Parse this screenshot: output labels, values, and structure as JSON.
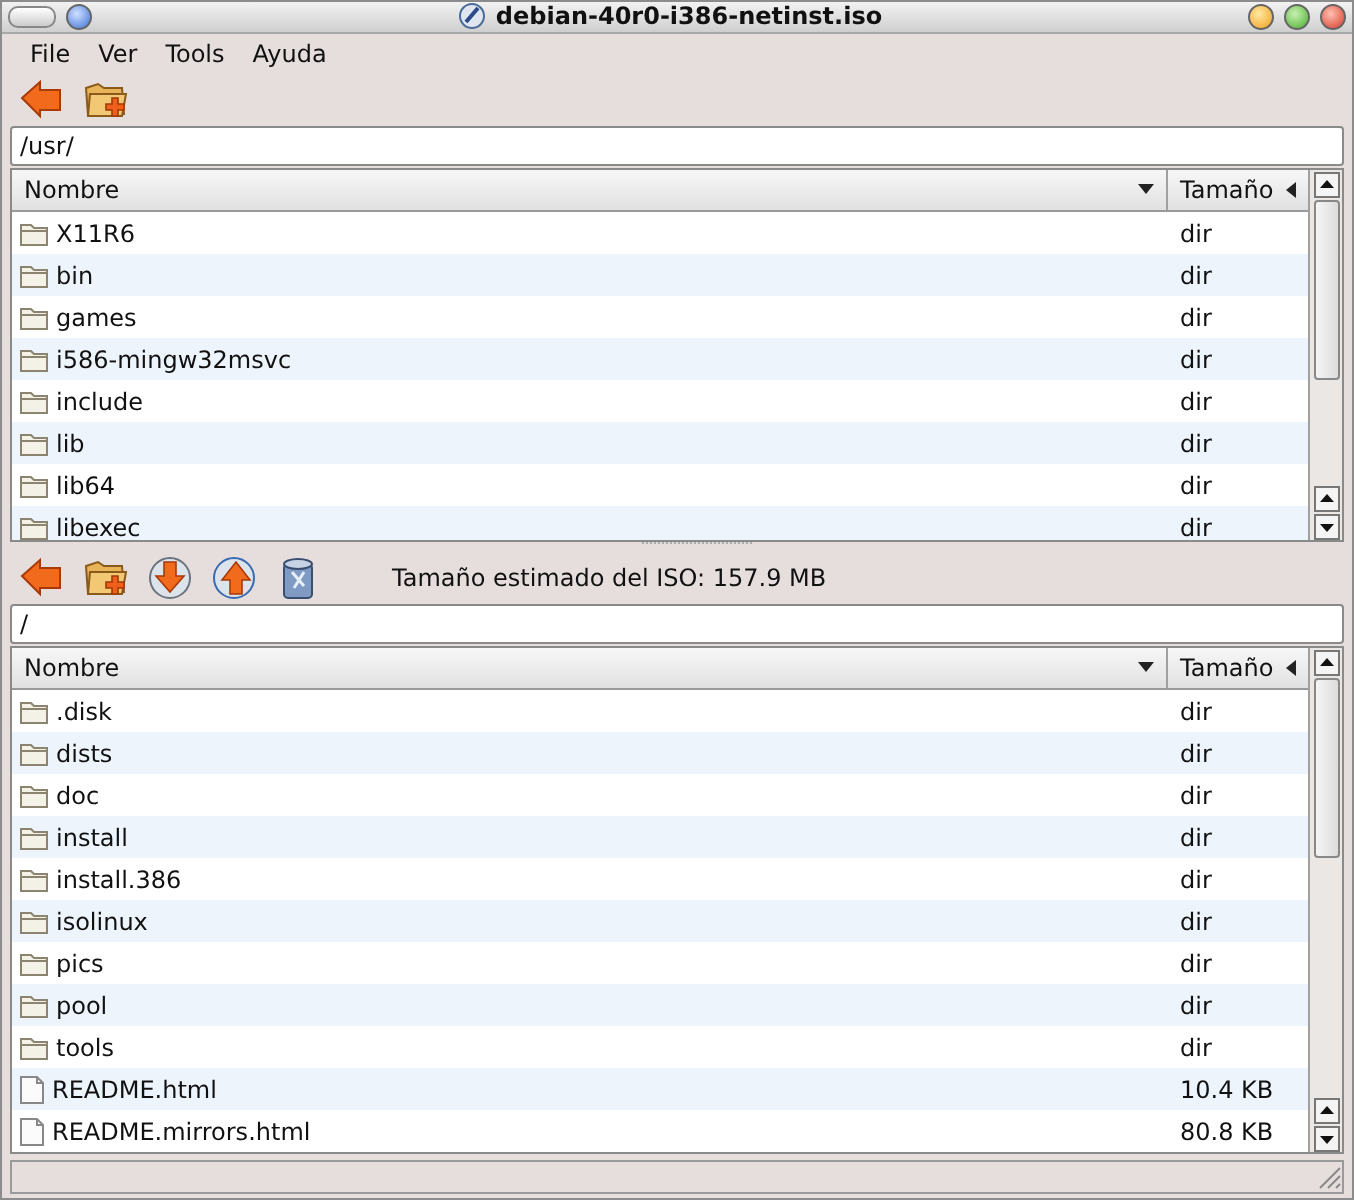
{
  "window": {
    "title": "debian-40r0-i386-netinst.iso"
  },
  "menu": [
    "File",
    "Ver",
    "Tools",
    "Ayuda"
  ],
  "top_pane": {
    "path": "/usr/",
    "columns": [
      "Nombre",
      "Tamaño"
    ],
    "rows": [
      {
        "kind": "folder",
        "name": "X11R6",
        "size": "dir"
      },
      {
        "kind": "folder",
        "name": "bin",
        "size": "dir"
      },
      {
        "kind": "folder",
        "name": "games",
        "size": "dir"
      },
      {
        "kind": "folder",
        "name": "i586-mingw32msvc",
        "size": "dir"
      },
      {
        "kind": "folder",
        "name": "include",
        "size": "dir"
      },
      {
        "kind": "folder",
        "name": "lib",
        "size": "dir"
      },
      {
        "kind": "folder",
        "name": "lib64",
        "size": "dir"
      },
      {
        "kind": "folder",
        "name": "libexec",
        "size": "dir"
      }
    ]
  },
  "iso_status": "Tamaño estimado del ISO: 157.9 MB",
  "bottom_pane": {
    "path": "/",
    "columns": [
      "Nombre",
      "Tamaño"
    ],
    "rows": [
      {
        "kind": "folder",
        "name": ".disk",
        "size": "dir"
      },
      {
        "kind": "folder",
        "name": "dists",
        "size": "dir"
      },
      {
        "kind": "folder",
        "name": "doc",
        "size": "dir"
      },
      {
        "kind": "folder",
        "name": "install",
        "size": "dir"
      },
      {
        "kind": "folder",
        "name": "install.386",
        "size": "dir"
      },
      {
        "kind": "folder",
        "name": "isolinux",
        "size": "dir"
      },
      {
        "kind": "folder",
        "name": "pics",
        "size": "dir"
      },
      {
        "kind": "folder",
        "name": "pool",
        "size": "dir"
      },
      {
        "kind": "folder",
        "name": "tools",
        "size": "dir"
      },
      {
        "kind": "file",
        "name": "README.html",
        "size": "10.4 KB"
      },
      {
        "kind": "file",
        "name": "README.mirrors.html",
        "size": "80.8 KB"
      }
    ]
  }
}
